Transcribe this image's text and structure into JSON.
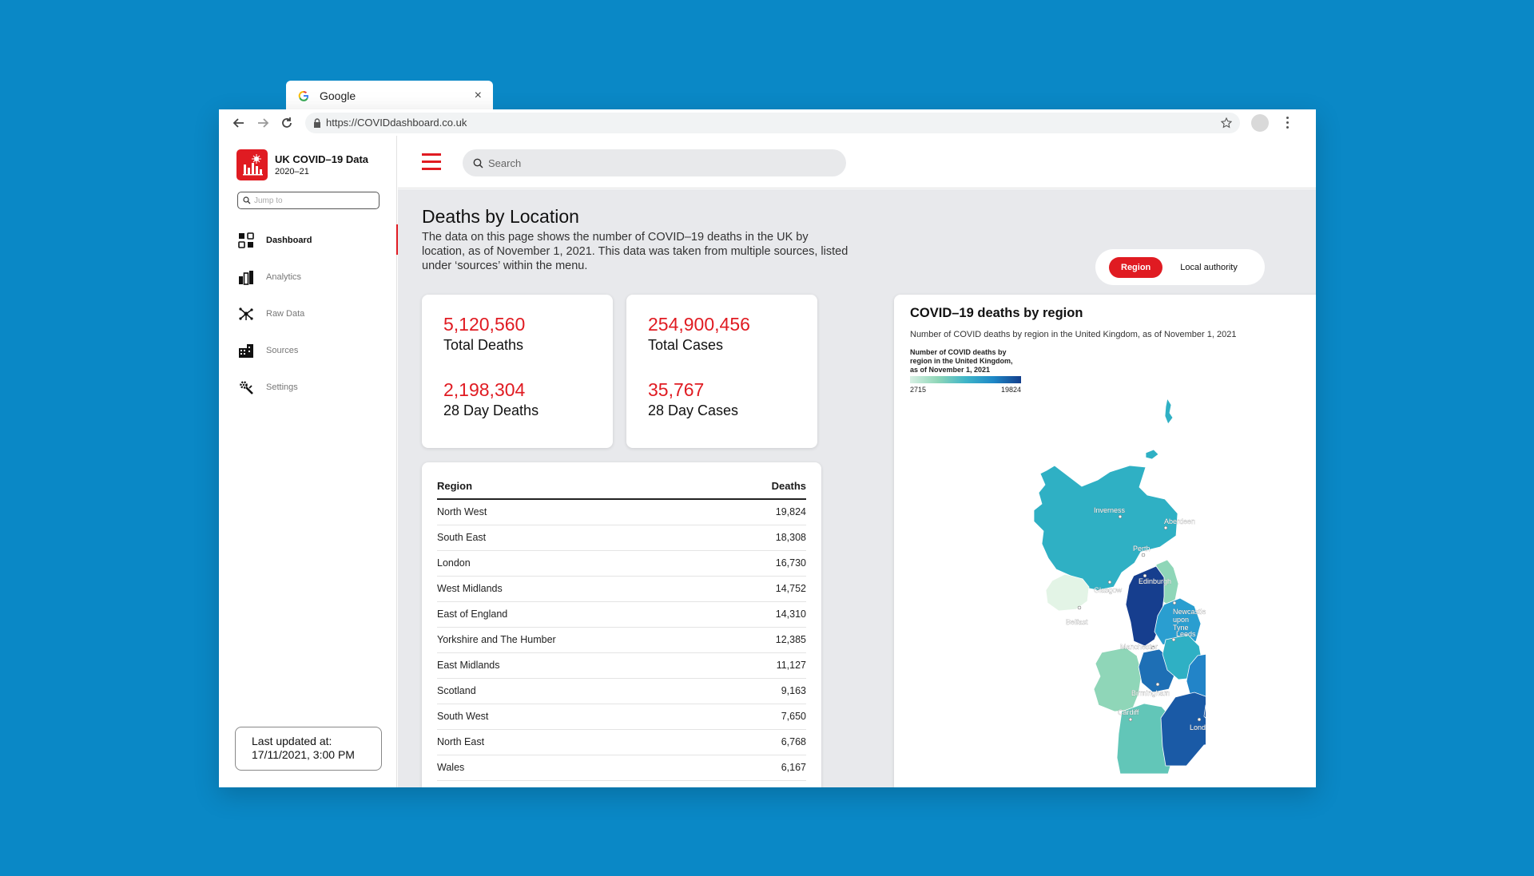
{
  "browser": {
    "tab_title": "Google",
    "tab_close": "×",
    "url": "https://COVIDdashboard.co.uk"
  },
  "sidebar": {
    "app_title": "UK COVID–19 Data",
    "app_subtitle": "2020–21",
    "jump_placeholder": "Jump to",
    "items": [
      {
        "label": "Dashboard",
        "icon": "dashboard-icon",
        "active": true
      },
      {
        "label": "Analytics",
        "icon": "analytics-icon",
        "active": false
      },
      {
        "label": "Raw Data",
        "icon": "raw-data-icon",
        "active": false
      },
      {
        "label": "Sources",
        "icon": "sources-icon",
        "active": false
      },
      {
        "label": "Settings",
        "icon": "settings-icon",
        "active": false
      }
    ],
    "last_updated_label": "Last updated at:",
    "last_updated_value": "17/11/2021, 3:00 PM"
  },
  "header": {
    "search_placeholder": "Search"
  },
  "page": {
    "title": "Deaths by Location",
    "description": "The data on this page shows the number of COVID–19 deaths in the UK by location, as of November 1, 2021. This data was taken from multiple sources, listed under ‘sources’ within the menu.",
    "toggle": {
      "active": "Region",
      "inactive": "Local authority"
    }
  },
  "stats": {
    "total_deaths": "5,120,560",
    "total_deaths_label": "Total Deaths",
    "day28_deaths": "2,198,304",
    "day28_deaths_label": "28 Day Deaths",
    "total_cases": "254,900,456",
    "total_cases_label": "Total Cases",
    "day28_cases": "35,767",
    "day28_cases_label": "28 Day Cases"
  },
  "table": {
    "headers": {
      "region": "Region",
      "deaths": "Deaths"
    },
    "rows": [
      {
        "region": "North West",
        "deaths": "19,824"
      },
      {
        "region": "South East",
        "deaths": "18,308"
      },
      {
        "region": "London",
        "deaths": "16,730"
      },
      {
        "region": "West Midlands",
        "deaths": "14,752"
      },
      {
        "region": "East of England",
        "deaths": "14,310"
      },
      {
        "region": "Yorkshire and The Humber",
        "deaths": "12,385"
      },
      {
        "region": "East Midlands",
        "deaths": "11,127"
      },
      {
        "region": "Scotland",
        "deaths": "9,163"
      },
      {
        "region": "South West",
        "deaths": "7,650"
      },
      {
        "region": "North East",
        "deaths": "6,768"
      },
      {
        "region": "Wales",
        "deaths": "6,167"
      }
    ]
  },
  "map": {
    "title": "COVID–19 deaths by region",
    "subtitle": "Number of COVID deaths by region in the United Kingdom, as of November 1, 2021",
    "legend_title": "Number of COVID deaths by region in the United Kingdom, as of November 1, 2021",
    "legend_min": "2715",
    "legend_max": "19824",
    "cities": [
      "Inverness",
      "Aberdeen",
      "Perth",
      "Glasgow",
      "Edinburgh",
      "Newcastle upon Tyne",
      "Belfast",
      "Leeds",
      "Manchester",
      "Birmingham",
      "Cardiff",
      "London"
    ],
    "colors": {
      "scotland": "#2fb0c4",
      "northern_ireland": "#e3f4e6",
      "north_east": "#8fd6b8",
      "north_west": "#163e8e",
      "yorkshire": "#2a9ed0",
      "east_midlands": "#2fb0c4",
      "west_midlands": "#1e6fb5",
      "wales": "#8fd6b8",
      "east_of_england": "#2284c8",
      "south_west": "#62c6b8",
      "south_east": "#1a5aa6",
      "london": "#0f4a96"
    }
  },
  "colors": {
    "accent": "#e01b22",
    "background": "#0a88c6"
  }
}
